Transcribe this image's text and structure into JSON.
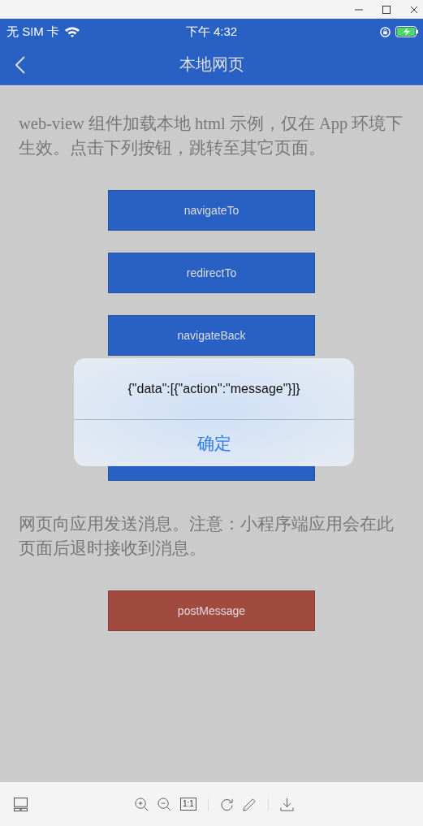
{
  "status_bar": {
    "carrier": "无 SIM 卡",
    "time": "下午 4:32"
  },
  "nav_bar": {
    "title": "本地网页"
  },
  "intro": "web-view 组件加载本地 html 示例，仅在 App 环境下生效。点击下列按钮，跳转至其它页面。",
  "nav_buttons": [
    {
      "label": "navigateTo",
      "kind": "primary"
    },
    {
      "label": "redirectTo",
      "kind": "primary"
    },
    {
      "label": "navigateBack",
      "kind": "primary"
    },
    {
      "kind": "primary"
    }
  ],
  "note": "网页向应用发送消息。注意：小程序端应用会在此页面后退时接收到消息。",
  "message_buttons": [
    {
      "label": "postMessage",
      "kind": "warn"
    }
  ],
  "dialog": {
    "message": "{\"data\":[{\"action\":\"message\"}]}",
    "confirm": "确定"
  },
  "viewer_toolbar": {
    "actual_size": "1:1"
  }
}
